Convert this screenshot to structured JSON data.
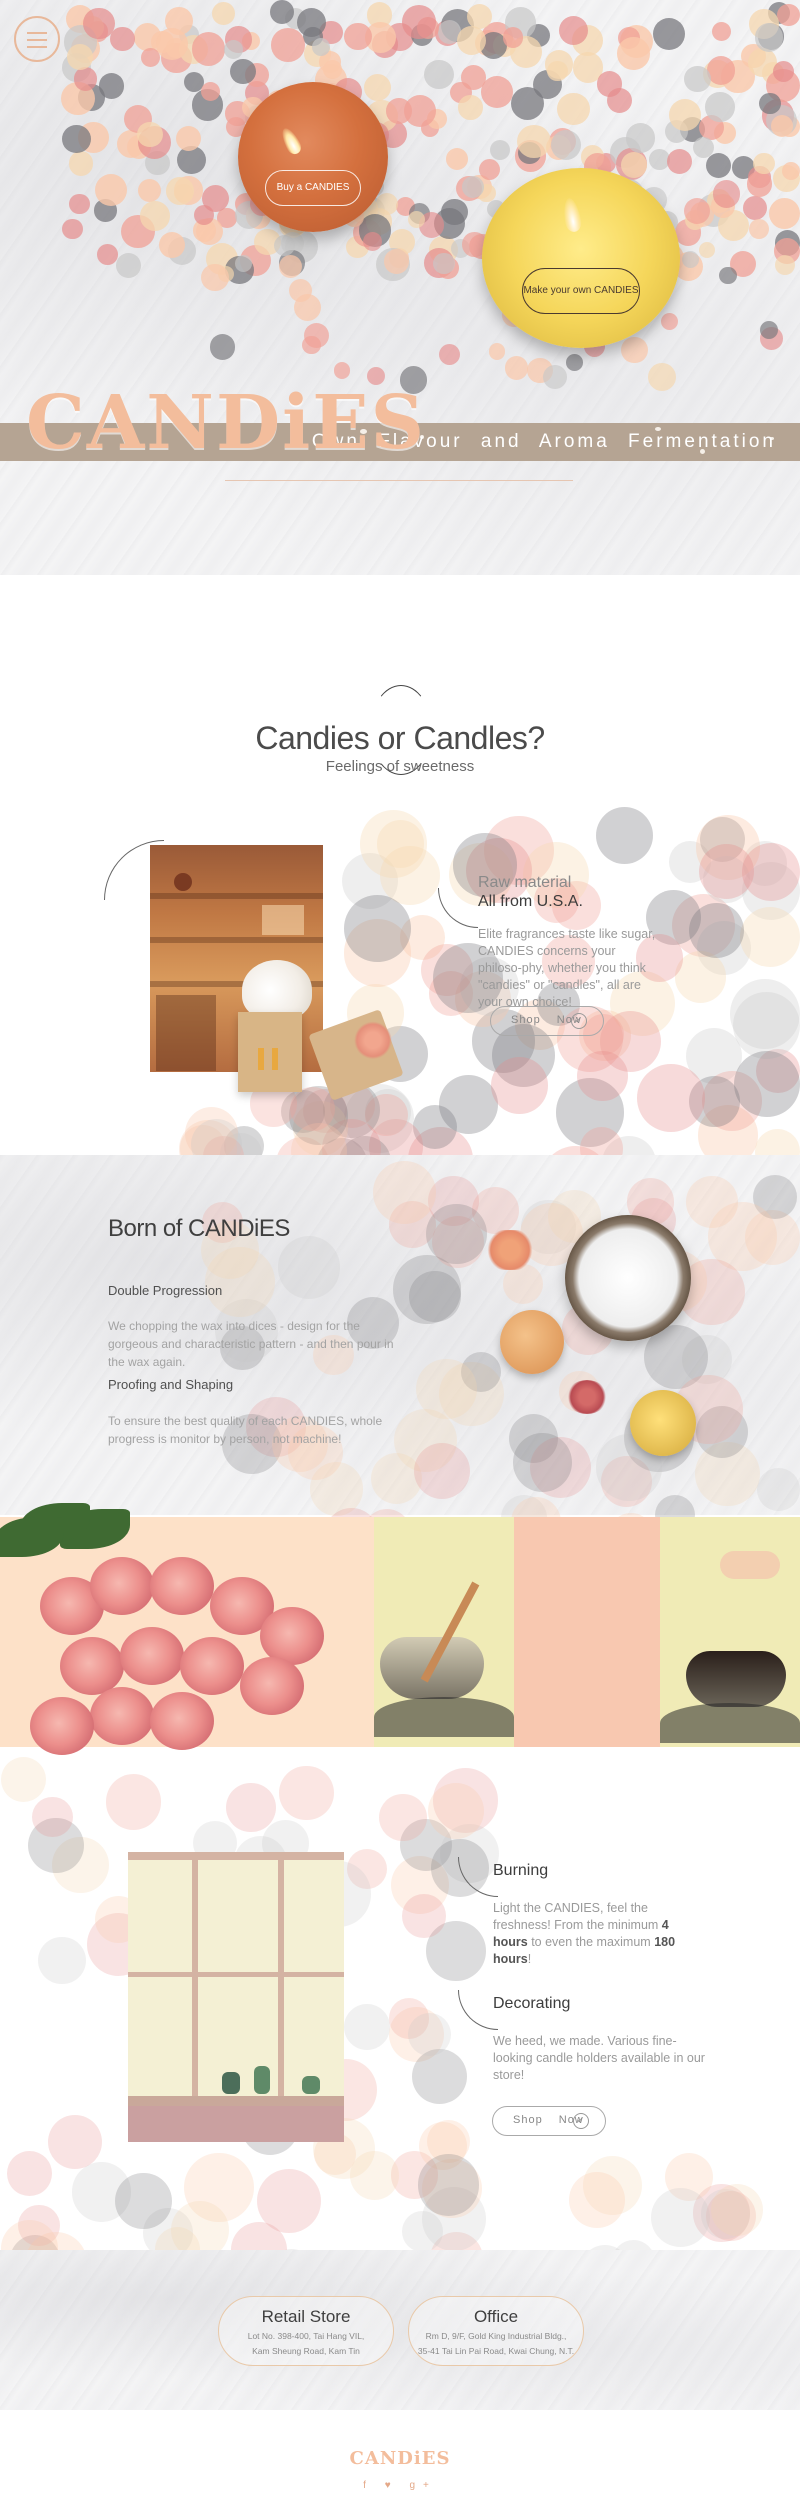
{
  "hero": {
    "buy_button": "Buy a CANDIES",
    "make_button": "Make your own CANDIES",
    "logo": "CANDiES",
    "tagline": "Own Flavour and Aroma Fermentation"
  },
  "intro": {
    "title": "Candies or Candles?",
    "subtitle": "Feelings of sweetness"
  },
  "raw_material": {
    "kicker": "Raw material",
    "heading": "All from U.S.A.",
    "body": "Elite fragrances taste like sugar, CANDIES concerns your philoso-phy, whether you think \"candies\" or \"candles\", all are your own choice!",
    "shop_label": "Shop Now"
  },
  "born": {
    "title": "Born of CANDiES",
    "item1_title": "Double Progression",
    "item1_body": "We chopping the wax into dices - design for the gorgeous and characteristic pattern - and then pour in the wax again.",
    "item2_title": "Proofing and Shaping",
    "item2_body": "To ensure the best quality of each CANDIES, whole progress is monitor by person, not machine!"
  },
  "burning": {
    "heading": "Burning",
    "body_pre": "Light the CANDIES, feel the freshness! From the minimum ",
    "min_hours": "4 hours",
    "body_mid": " to even the maximum ",
    "max_hours": "180 hours",
    "body_post": "!"
  },
  "decorating": {
    "heading": "Decorating",
    "body": "We heed, we made. Various fine-looking candle holders available in our store!",
    "shop_label": "Shop Now"
  },
  "footer": {
    "retail_title": "Retail Store",
    "retail_addr_1": "Lot No. 398-400, Tai Hang VIL,",
    "retail_addr_2": "Kam Sheung Road, Kam Tin",
    "office_title": "Office",
    "office_addr_1": "Rm D, 9/F, Gold King Industrial Bldg.,",
    "office_addr_2": "35-41 Tai Lin Pai Road, Kwai Chung, N.T.",
    "logo": "CANDiES",
    "social": "f  t  g+"
  },
  "icons": [
    "menu-icon",
    "check-icon",
    "facebook-icon",
    "twitter-icon",
    "google-plus-icon"
  ]
}
